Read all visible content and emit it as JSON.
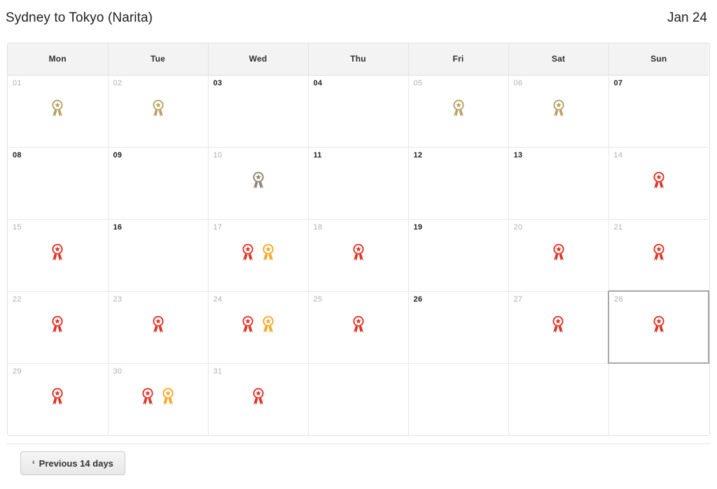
{
  "header": {
    "title": "Sydney to Tokyo (Narita)",
    "month": "Jan 24"
  },
  "weekdays": [
    "Mon",
    "Tue",
    "Wed",
    "Thu",
    "Fri",
    "Sat",
    "Sun"
  ],
  "legend_colors": {
    "gold": "#b5a263",
    "gray": "#8c8274",
    "red": "#e03226",
    "orange": "#f5a623"
  },
  "icon_name": "award-rosette-icon",
  "weeks": [
    {
      "days": [
        {
          "num": "01",
          "strong": false,
          "icons": [
            "gold"
          ]
        },
        {
          "num": "02",
          "strong": false,
          "icons": [
            "gold"
          ]
        },
        {
          "num": "03",
          "strong": true,
          "icons": []
        },
        {
          "num": "04",
          "strong": true,
          "icons": []
        },
        {
          "num": "05",
          "strong": false,
          "icons": [
            "gold"
          ]
        },
        {
          "num": "06",
          "strong": false,
          "icons": [
            "gold"
          ]
        },
        {
          "num": "07",
          "strong": true,
          "icons": []
        }
      ]
    },
    {
      "days": [
        {
          "num": "08",
          "strong": true,
          "icons": []
        },
        {
          "num": "09",
          "strong": true,
          "icons": []
        },
        {
          "num": "10",
          "strong": false,
          "icons": [
            "gray"
          ]
        },
        {
          "num": "11",
          "strong": true,
          "icons": []
        },
        {
          "num": "12",
          "strong": true,
          "icons": []
        },
        {
          "num": "13",
          "strong": true,
          "icons": []
        },
        {
          "num": "14",
          "strong": false,
          "icons": [
            "red"
          ]
        }
      ]
    },
    {
      "days": [
        {
          "num": "15",
          "strong": false,
          "icons": [
            "red"
          ]
        },
        {
          "num": "16",
          "strong": true,
          "icons": []
        },
        {
          "num": "17",
          "strong": false,
          "icons": [
            "red",
            "orange"
          ]
        },
        {
          "num": "18",
          "strong": false,
          "icons": [
            "red"
          ]
        },
        {
          "num": "19",
          "strong": true,
          "icons": []
        },
        {
          "num": "20",
          "strong": false,
          "icons": [
            "red"
          ]
        },
        {
          "num": "21",
          "strong": false,
          "icons": [
            "red"
          ]
        }
      ]
    },
    {
      "days": [
        {
          "num": "22",
          "strong": false,
          "icons": [
            "red"
          ]
        },
        {
          "num": "23",
          "strong": false,
          "icons": [
            "red"
          ]
        },
        {
          "num": "24",
          "strong": false,
          "icons": [
            "red",
            "orange"
          ]
        },
        {
          "num": "25",
          "strong": false,
          "icons": [
            "red"
          ]
        },
        {
          "num": "26",
          "strong": true,
          "icons": []
        },
        {
          "num": "27",
          "strong": false,
          "icons": [
            "red"
          ]
        },
        {
          "num": "28",
          "strong": false,
          "icons": [
            "red"
          ],
          "selected": true
        }
      ]
    },
    {
      "days": [
        {
          "num": "29",
          "strong": false,
          "icons": [
            "red"
          ]
        },
        {
          "num": "30",
          "strong": false,
          "icons": [
            "red",
            "orange"
          ]
        },
        {
          "num": "31",
          "strong": false,
          "icons": [
            "red"
          ]
        },
        {
          "num": "",
          "strong": false,
          "icons": []
        },
        {
          "num": "",
          "strong": false,
          "icons": []
        },
        {
          "num": "",
          "strong": false,
          "icons": []
        },
        {
          "num": "",
          "strong": false,
          "icons": []
        }
      ]
    }
  ],
  "footer": {
    "prev_label": "Previous 14 days",
    "prev_chevron": "‹"
  }
}
